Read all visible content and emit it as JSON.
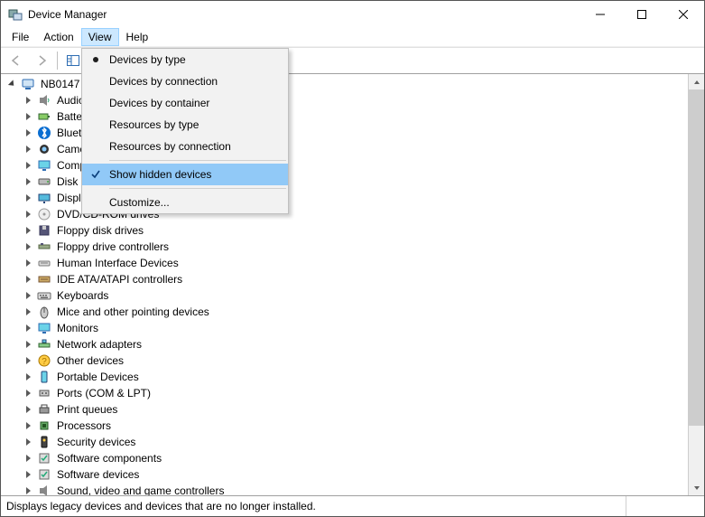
{
  "window": {
    "title": "Device Manager"
  },
  "menubar": {
    "file": "File",
    "action": "Action",
    "view": "View",
    "help": "Help"
  },
  "view_menu": {
    "by_type": "Devices by type",
    "by_connection": "Devices by connection",
    "by_container": "Devices by container",
    "res_by_type": "Resources by type",
    "res_by_connection": "Resources by connection",
    "show_hidden": "Show hidden devices",
    "customize": "Customize..."
  },
  "tree": {
    "root": "NB0147",
    "items": [
      {
        "label": "Audio inputs and outputs",
        "icon": "speaker"
      },
      {
        "label": "Batteries",
        "icon": "battery"
      },
      {
        "label": "Bluetooth",
        "icon": "bluetooth"
      },
      {
        "label": "Cameras",
        "icon": "camera"
      },
      {
        "label": "Computer",
        "icon": "monitor"
      },
      {
        "label": "Disk drives",
        "icon": "disk"
      },
      {
        "label": "Display adapters",
        "icon": "display"
      },
      {
        "label": "DVD/CD-ROM drives",
        "icon": "cd"
      },
      {
        "label": "Floppy disk drives",
        "icon": "floppy"
      },
      {
        "label": "Floppy drive controllers",
        "icon": "floppyctrl"
      },
      {
        "label": "Human Interface Devices",
        "icon": "hid"
      },
      {
        "label": "IDE ATA/ATAPI controllers",
        "icon": "ide"
      },
      {
        "label": "Keyboards",
        "icon": "keyboard"
      },
      {
        "label": "Mice and other pointing devices",
        "icon": "mouse"
      },
      {
        "label": "Monitors",
        "icon": "monitor"
      },
      {
        "label": "Network adapters",
        "icon": "network"
      },
      {
        "label": "Other devices",
        "icon": "other"
      },
      {
        "label": "Portable Devices",
        "icon": "portable"
      },
      {
        "label": "Ports (COM & LPT)",
        "icon": "port"
      },
      {
        "label": "Print queues",
        "icon": "printer"
      },
      {
        "label": "Processors",
        "icon": "cpu"
      },
      {
        "label": "Security devices",
        "icon": "security"
      },
      {
        "label": "Software components",
        "icon": "software"
      },
      {
        "label": "Software devices",
        "icon": "software"
      },
      {
        "label": "Sound, video and game controllers",
        "icon": "sound"
      }
    ]
  },
  "statusbar": {
    "text": "Displays legacy devices and devices that are no longer installed."
  }
}
